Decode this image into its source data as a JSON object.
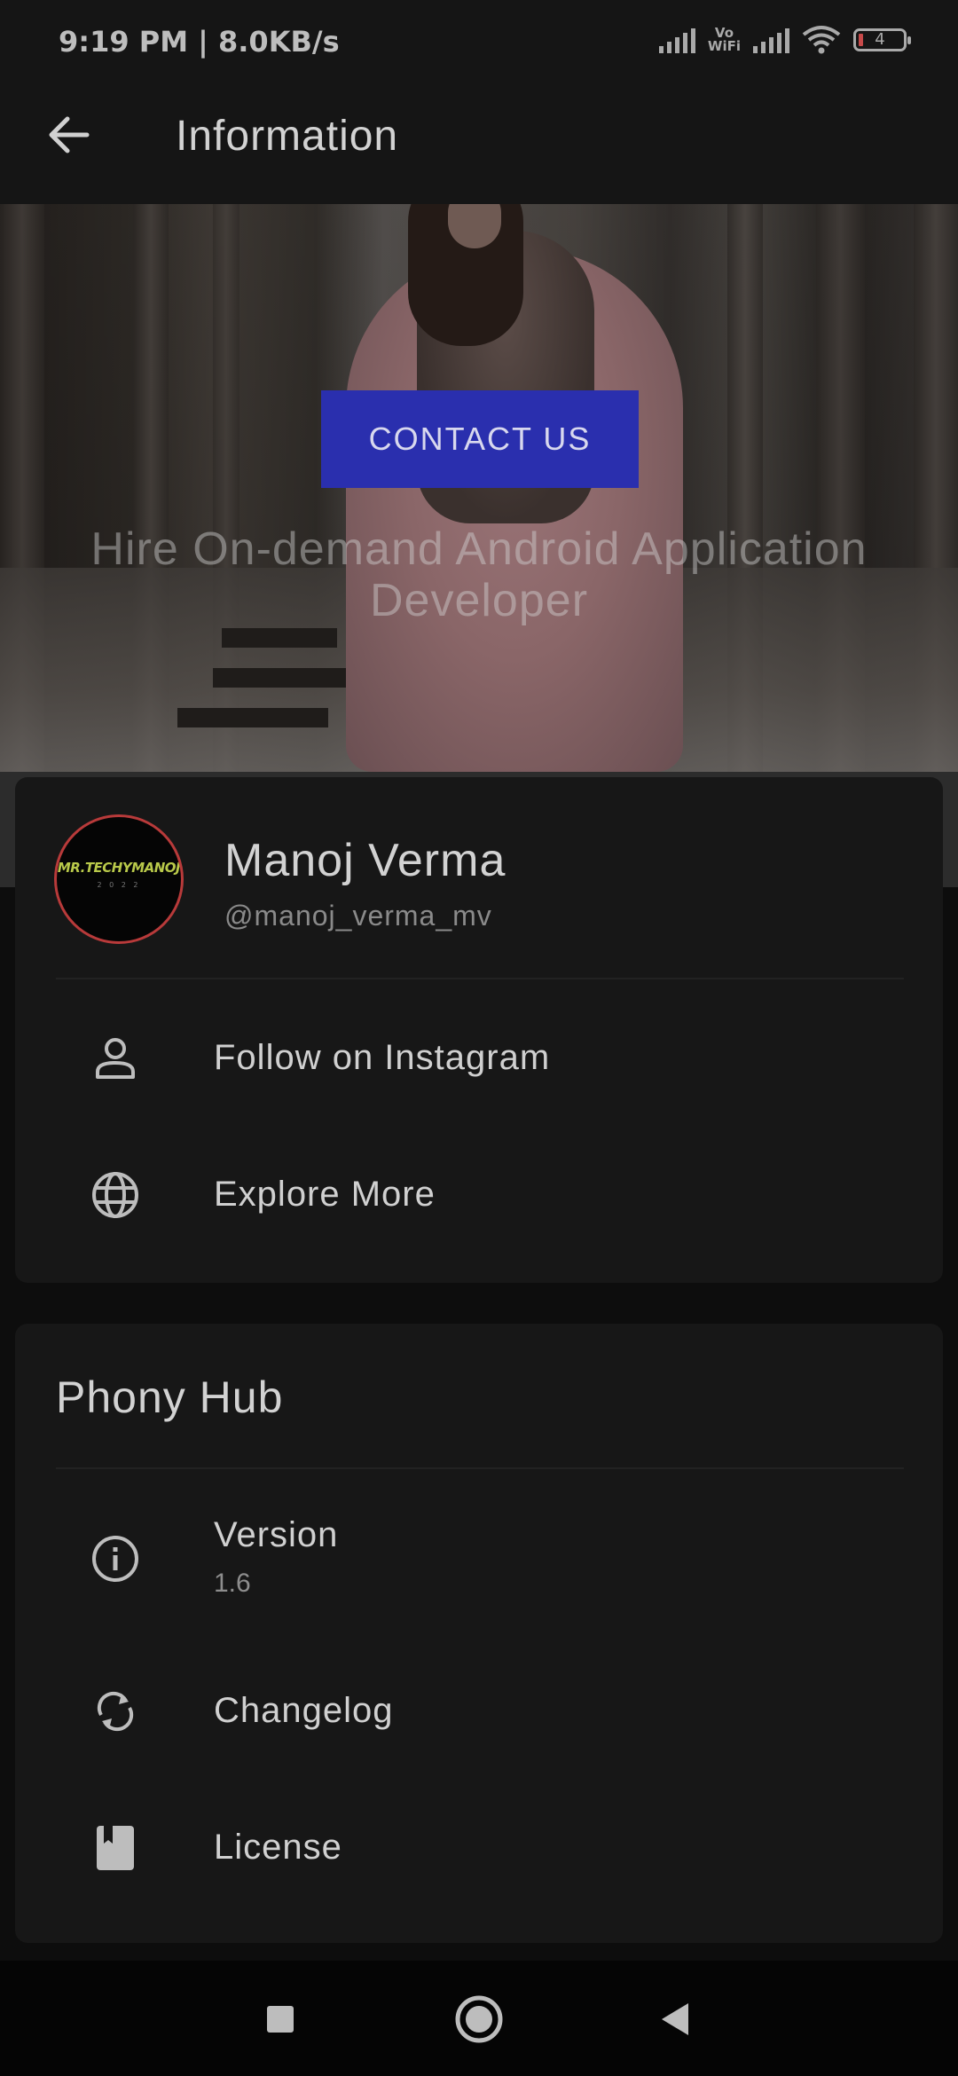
{
  "status_bar": {
    "time": "9:19 PM | 8.0KB/s",
    "vowifi": "Vo\nWiFi",
    "battery": "4",
    "icons": [
      "signal-icon",
      "vowifi-icon",
      "signal-icon",
      "wifi-icon",
      "battery-icon"
    ]
  },
  "app_bar": {
    "title": "Information",
    "back_icon": "arrow-back-icon"
  },
  "hero": {
    "button_label": "CONTACT US",
    "tagline": "Hire On-demand Android Application Developer"
  },
  "profile": {
    "avatar_text": "MR.TECHYMANOJ",
    "avatar_sub": "2 0 2 2",
    "name": "Manoj Verma",
    "handle": "@manoj_verma_mv",
    "items": [
      {
        "label": "Follow on Instagram",
        "icon": "person-icon"
      },
      {
        "label": "Explore More",
        "icon": "globe-icon"
      }
    ]
  },
  "app_info": {
    "title": "Phony Hub",
    "items": [
      {
        "label": "Version",
        "sub": "1.6",
        "icon": "info-icon"
      },
      {
        "label": "Changelog",
        "icon": "sync-icon"
      },
      {
        "label": "License",
        "icon": "book-icon"
      }
    ]
  },
  "nav_bar": {
    "buttons": [
      "recents-icon",
      "home-icon",
      "back-triangle-icon"
    ]
  },
  "colors": {
    "background": "#0d0d0d",
    "card": "#171717",
    "accent_button": "#2a2fae",
    "avatar_border": "#b83a3a"
  }
}
